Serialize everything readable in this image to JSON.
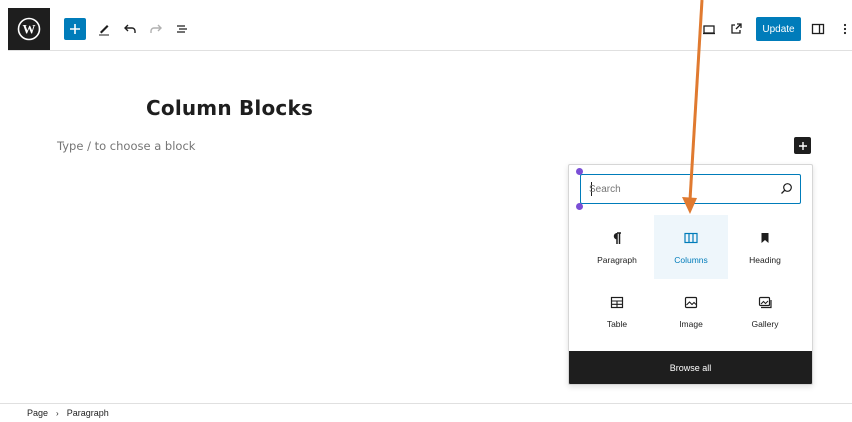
{
  "toolbar": {
    "update_label": "Update",
    "icons": [
      "wordpress-logo",
      "plus",
      "pencil",
      "undo",
      "redo",
      "list-view",
      "desktop-preview",
      "external-link",
      "settings-sidebar",
      "more-vertical"
    ]
  },
  "editor": {
    "title": "Column Blocks",
    "placeholder": "Type / to choose a block"
  },
  "inserter": {
    "search_placeholder": "Search",
    "search_value": "",
    "blocks": [
      {
        "label": "Paragraph",
        "icon": "pilcrow-icon"
      },
      {
        "label": "Columns",
        "icon": "columns-icon"
      },
      {
        "label": "Heading",
        "icon": "bookmark-icon"
      },
      {
        "label": "Table",
        "icon": "table-icon"
      },
      {
        "label": "Image",
        "icon": "image-icon"
      },
      {
        "label": "Gallery",
        "icon": "gallery-icon"
      }
    ],
    "browse_all_label": "Browse all"
  },
  "footer": {
    "breadcrumb": [
      "Page",
      "Paragraph"
    ]
  },
  "colors": {
    "accent": "#007cba",
    "dark": "#1e1e1e",
    "annotation_arrow": "#e07a30",
    "selection_handle": "#7a4fd6"
  }
}
